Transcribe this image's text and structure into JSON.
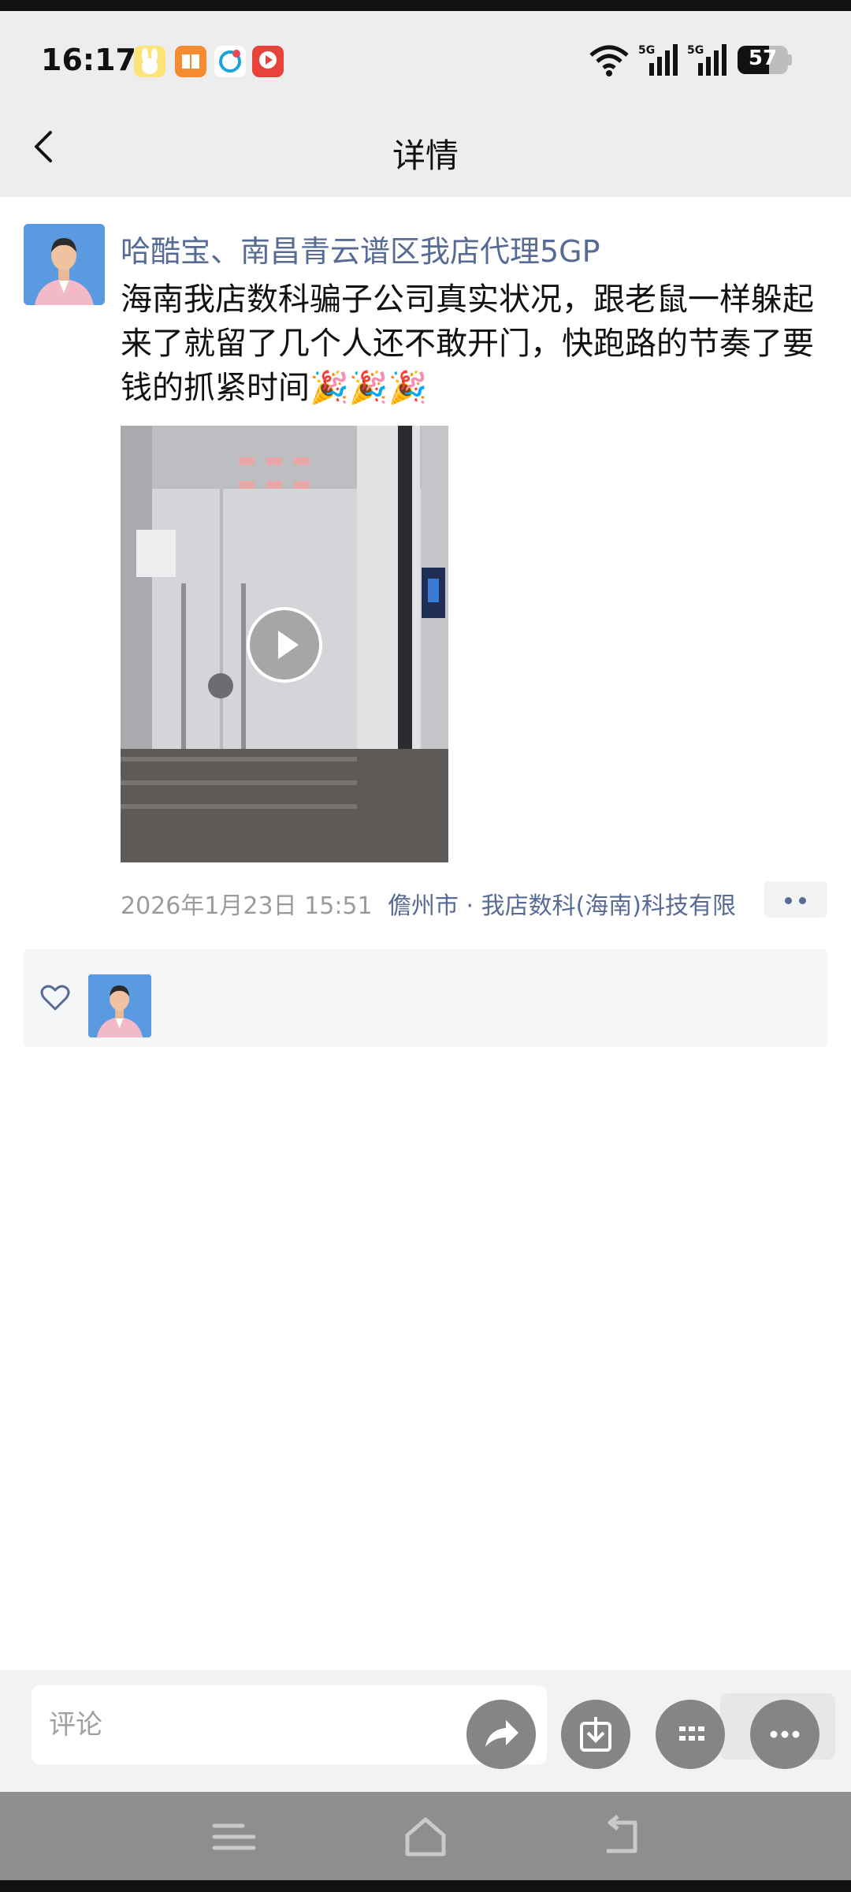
{
  "status_bar": {
    "time": "16:17",
    "battery": "57",
    "network": [
      "5G",
      "5G"
    ],
    "icons": [
      "wifi-icon",
      "signal-icon",
      "signal-icon",
      "battery-icon"
    ],
    "app_icons": [
      "bunny-app-icon",
      "reader-app-icon",
      "mobile-app-icon",
      "video-app-icon"
    ]
  },
  "nav": {
    "title": "详情",
    "back_icon": "chevron-left-icon"
  },
  "post": {
    "username": "哈酷宝、南昌青云谱区我店代理5GP",
    "text": "海南我店数科骗子公司真实状况，跟老鼠一样躲起来了就留了几个人还不敢开门，快跑路的节奏了要钱的抓紧时间🎉🎉🎉",
    "timestamp": "2026年1月23日 15:51",
    "location": "儋州市 · 我店数科(海南)科技有限",
    "video_icon": "play-icon",
    "more_icon": "more-dots-icon"
  },
  "likes": {
    "heart_icon": "heart-outline-icon"
  },
  "comment": {
    "placeholder": "评论"
  },
  "floating_actions": [
    "share-arrow-icon",
    "save-download-icon",
    "grid-icon",
    "more-icon"
  ],
  "colors": {
    "link": "#576b95",
    "status_bg": "#ededed",
    "fab": "#858585"
  }
}
